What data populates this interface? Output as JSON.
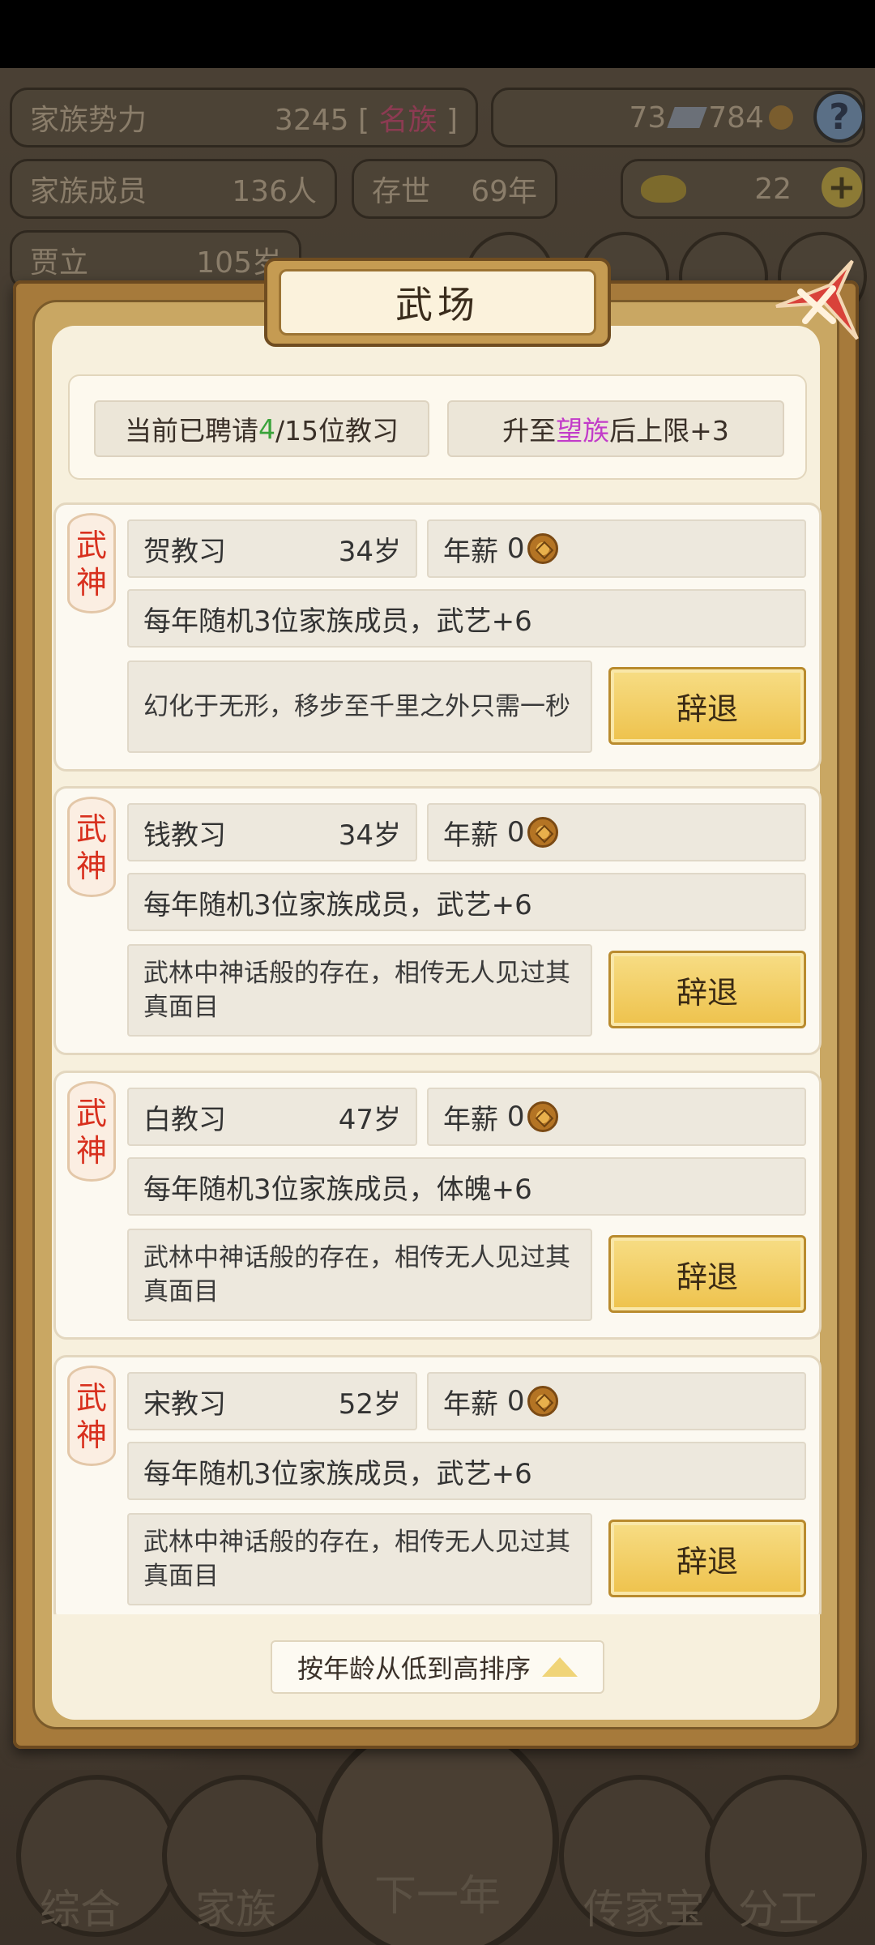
{
  "background": {
    "family_power_label": "家族势力",
    "family_power_value": "3245",
    "family_rank": "名族",
    "family_members_label": "家族成员",
    "family_members_value": "136人",
    "years_label": "存世",
    "years_value": "69年",
    "silver_value": "73",
    "coin_value": "784",
    "gold_value": "22",
    "person_name": "贾立",
    "person_age": "105岁",
    "nav": [
      "综合",
      "家族",
      "下一年",
      "传家宝",
      "分工"
    ]
  },
  "dialog": {
    "title": "武场",
    "hired_prefix": "当前已聘请",
    "hired_count": "4",
    "hired_suffix": "/15位教习",
    "upgrade_prefix": "升至",
    "upgrade_rank": "望族",
    "upgrade_suffix": "后上限+3",
    "sort_label": "按年龄从低到高排序"
  },
  "coaches": [
    {
      "rank_tag": "武神",
      "name": "贺教习",
      "age": "34岁",
      "salary_label": "年薪",
      "salary": "0",
      "effect": "每年随机3位家族成员，武艺+6",
      "description": "幻化于无形，移步至千里之外只需一秒",
      "dismiss_label": "辞退"
    },
    {
      "rank_tag": "武神",
      "name": "钱教习",
      "age": "34岁",
      "salary_label": "年薪",
      "salary": "0",
      "effect": "每年随机3位家族成员，武艺+6",
      "description": "武林中神话般的存在，相传无人见过其真面目",
      "dismiss_label": "辞退"
    },
    {
      "rank_tag": "武神",
      "name": "白教习",
      "age": "47岁",
      "salary_label": "年薪",
      "salary": "0",
      "effect": "每年随机3位家族成员，体魄+6",
      "description": "武林中神话般的存在，相传无人见过其真面目",
      "dismiss_label": "辞退"
    },
    {
      "rank_tag": "武神",
      "name": "宋教习",
      "age": "52岁",
      "salary_label": "年薪",
      "salary": "0",
      "effect": "每年随机3位家族成员，武艺+6",
      "description": "武林中神话般的存在，相传无人见过其真面目",
      "dismiss_label": "辞退"
    }
  ]
}
